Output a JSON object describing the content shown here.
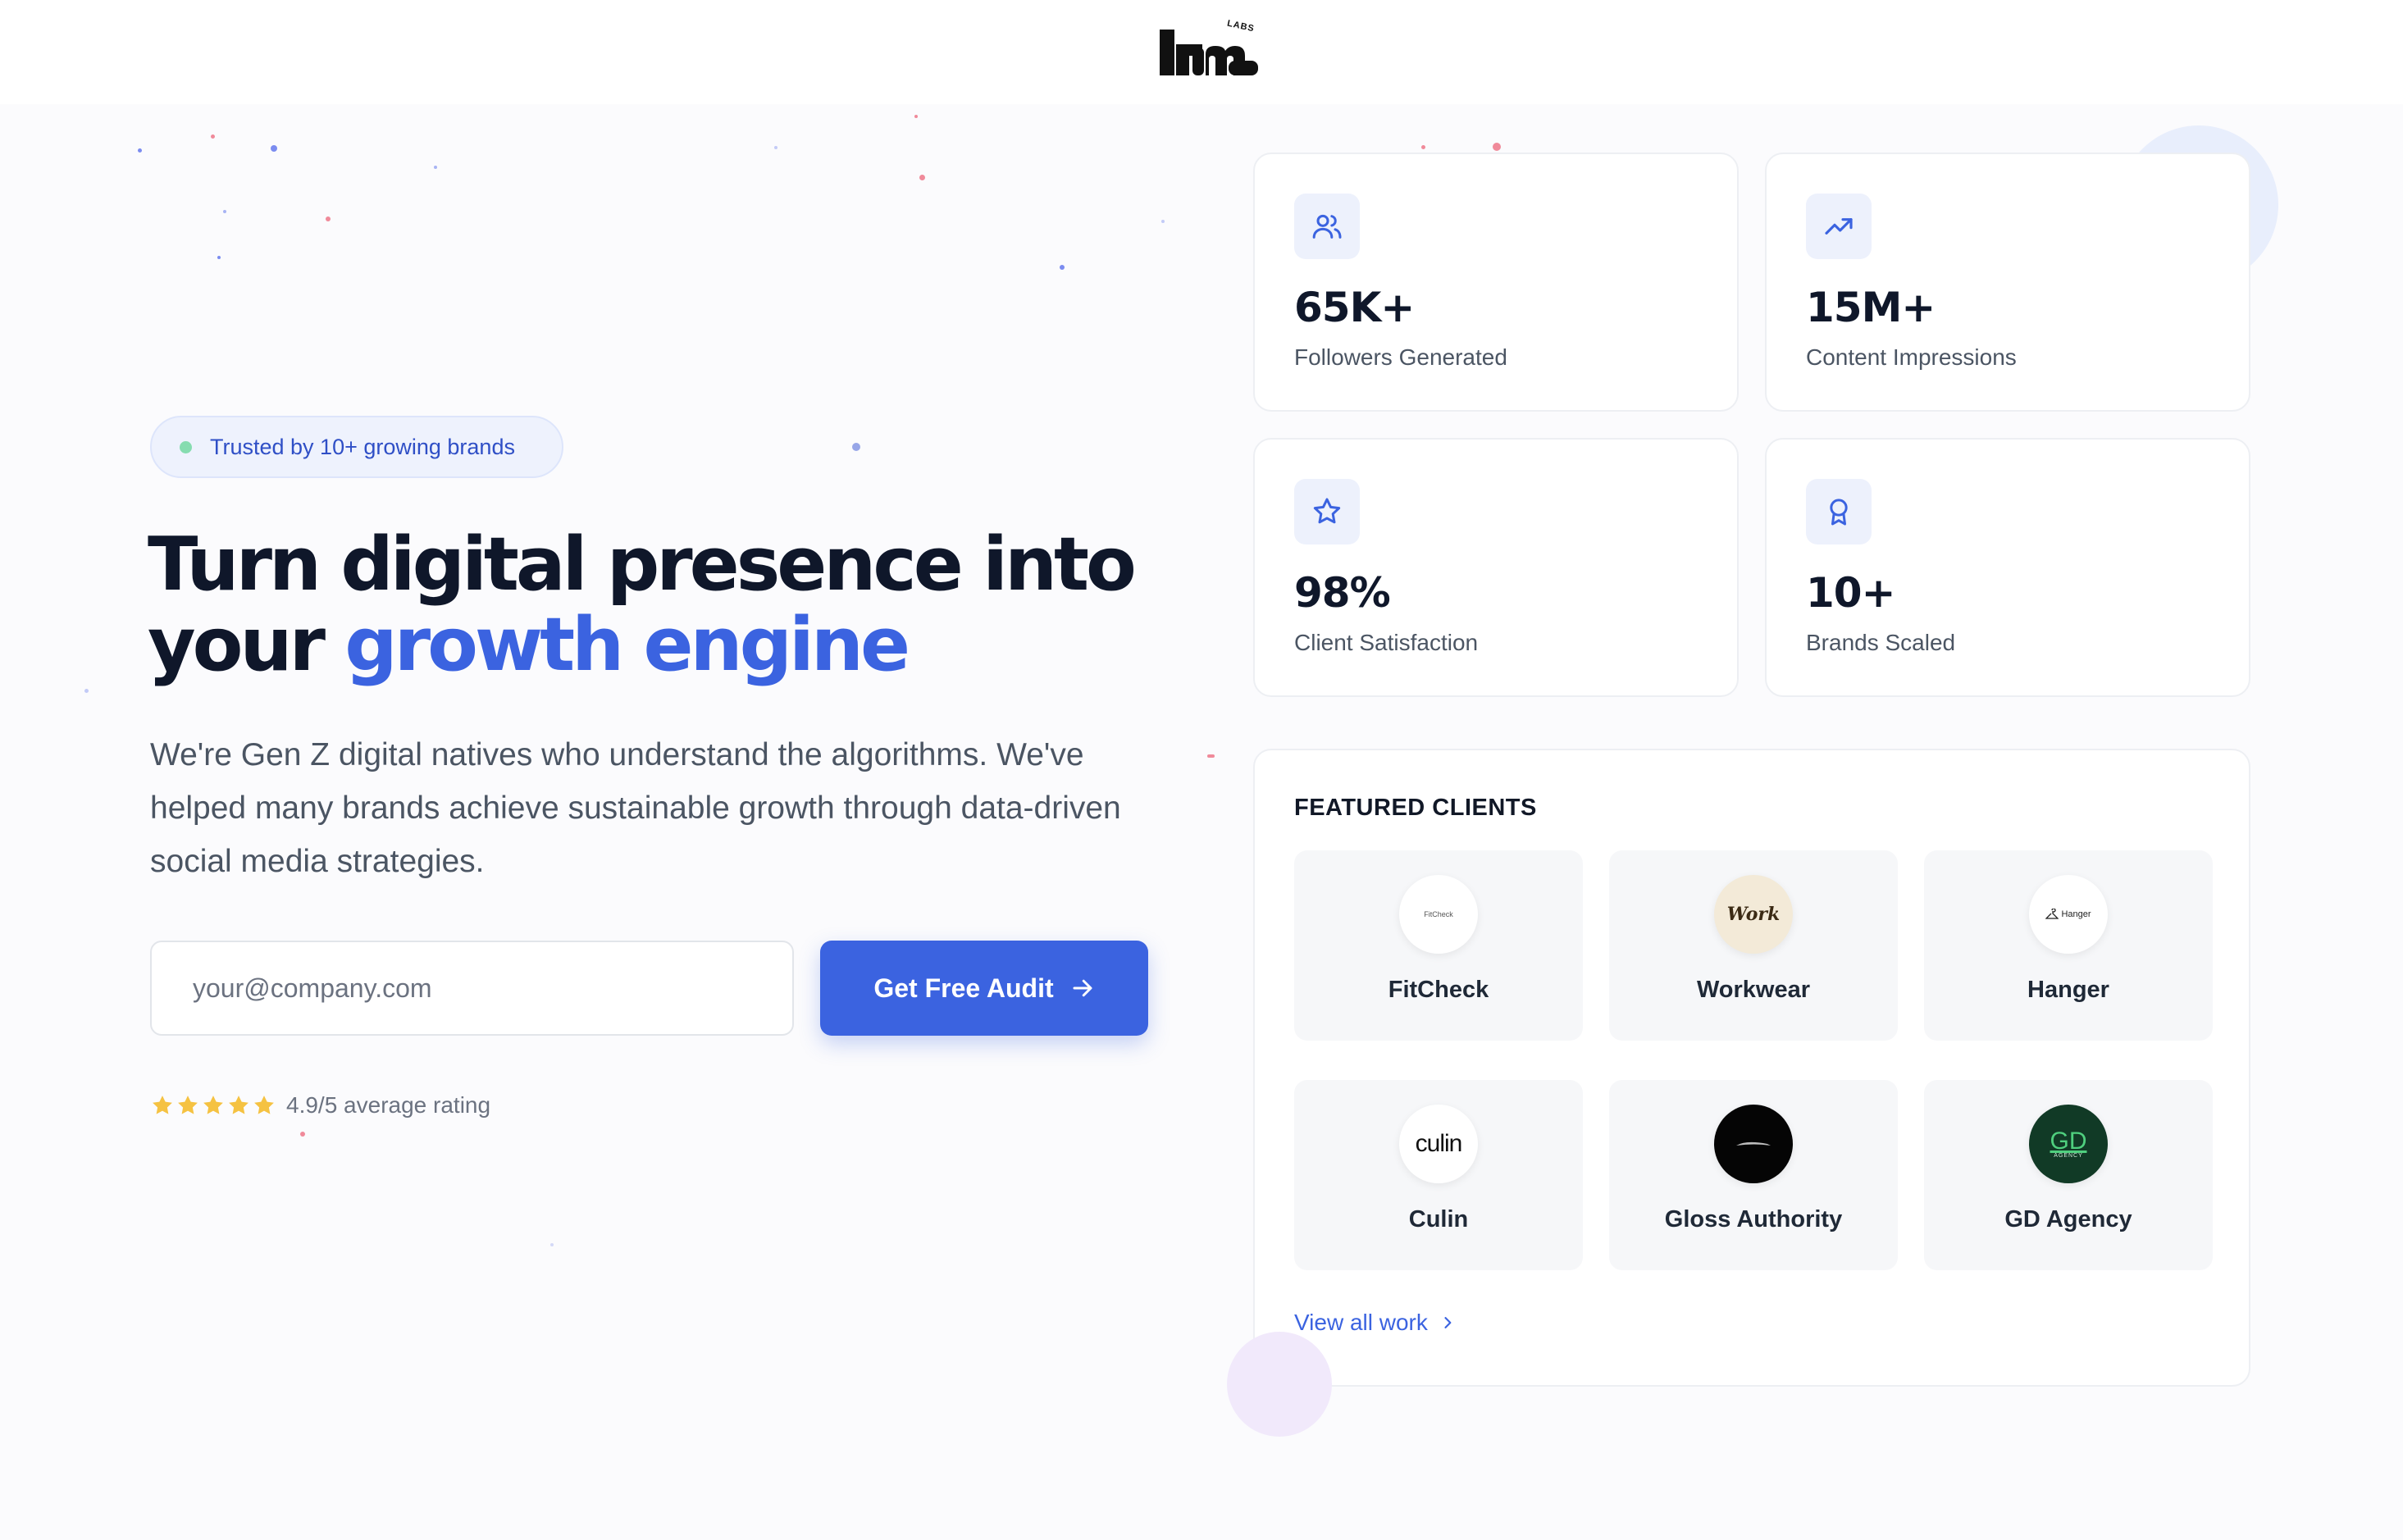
{
  "brand": {
    "logo_text": "lume",
    "logo_sub": "LABS"
  },
  "hero": {
    "badge": "Trusted by 10+ growing brands",
    "headline_line1": "Turn digital presence into",
    "headline_line2_plain": "your ",
    "headline_line2_accent": "growth engine",
    "subcopy": "We're Gen Z digital natives who understand the algorithms. We've helped many brands achieve sustainable growth through data-driven social media strategies.",
    "email_placeholder": "your@company.com",
    "cta_label": "Get Free Audit",
    "rating_stars": 5,
    "rating_text": "4.9/5 average rating"
  },
  "stats": [
    {
      "value": "65K+",
      "label": "Followers Generated",
      "icon": "users-icon"
    },
    {
      "value": "15M+",
      "label": "Content Impressions",
      "icon": "trending-up-icon"
    },
    {
      "value": "98%",
      "label": "Client Satisfaction",
      "icon": "star-icon"
    },
    {
      "value": "10+",
      "label": "Brands Scaled",
      "icon": "award-icon"
    }
  ],
  "clients": {
    "title": "FEATURED CLIENTS",
    "items": [
      {
        "name": "FitCheck",
        "logo_text": "FitCheck"
      },
      {
        "name": "Workwear",
        "logo_text": "Work"
      },
      {
        "name": "Hanger",
        "logo_text": "Hanger"
      },
      {
        "name": "Culin",
        "logo_text": "culin"
      },
      {
        "name": "Gloss Authority",
        "logo_text": ""
      },
      {
        "name": "GD Agency",
        "logo_text": "GD",
        "logo_sub": "AGENCY"
      }
    ],
    "view_all": "View all work"
  },
  "colors": {
    "accent": "#3b63e0",
    "text": "#0f172a",
    "muted": "#4b5563",
    "badge_bg": "#eef2fd",
    "star": "#f5c242"
  }
}
